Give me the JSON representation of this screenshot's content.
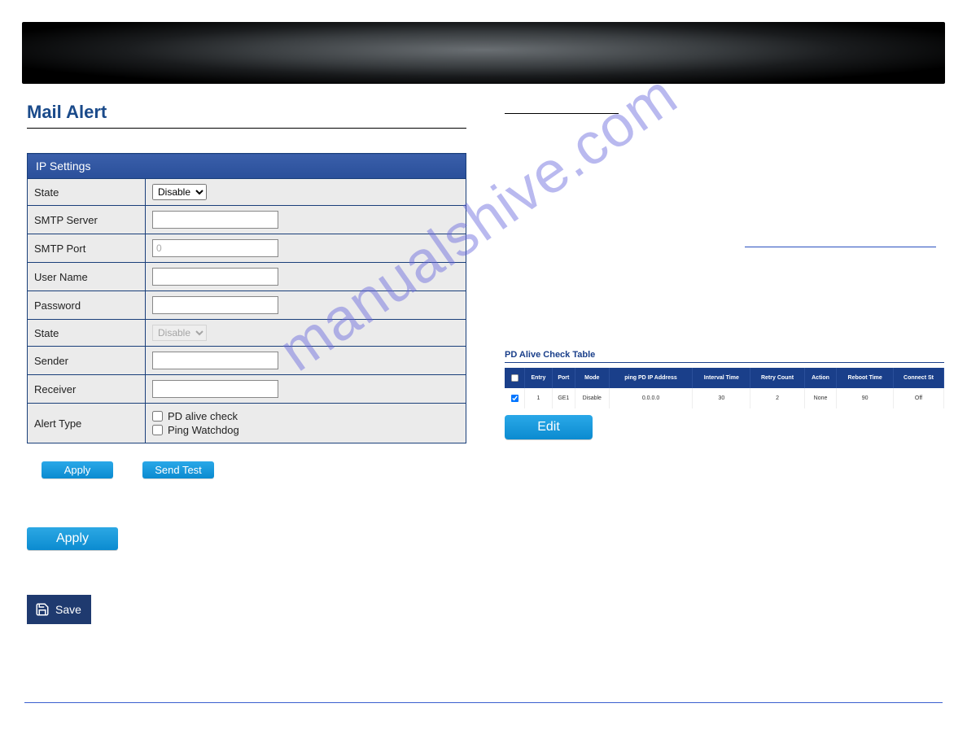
{
  "page": {
    "title": "Mail Alert"
  },
  "form": {
    "section_header": "IP Settings",
    "rows": {
      "state1_label": "State",
      "state1_value": "Disable",
      "smtp_server_label": "SMTP Server",
      "smtp_server_value": "",
      "smtp_port_label": "SMTP Port",
      "smtp_port_value": "0",
      "user_name_label": "User Name",
      "user_name_value": "",
      "password_label": "Password",
      "password_value": "",
      "state2_label": "State",
      "state2_value": "Disable",
      "sender_label": "Sender",
      "sender_value": "",
      "receiver_label": "Receiver",
      "receiver_value": "",
      "alert_type_label": "Alert Type",
      "alert_opt1": "PD alive check",
      "alert_opt2": "Ping Watchdog"
    },
    "buttons": {
      "apply_sm": "Apply",
      "send_test": "Send Test",
      "apply_md": "Apply",
      "save": "Save"
    }
  },
  "pd": {
    "title": "PD Alive Check Table",
    "columns": [
      "",
      "Entry",
      "Port",
      "Mode",
      "ping PD IP Address",
      "Interval Time",
      "Retry Count",
      "Action",
      "Reboot Time",
      "Connect St"
    ],
    "row": [
      "",
      "1",
      "GE1",
      "Disable",
      "0.0.0.0",
      "30",
      "2",
      "None",
      "90",
      "Off"
    ],
    "edit": "Edit"
  },
  "watermark": "manualshive.com"
}
